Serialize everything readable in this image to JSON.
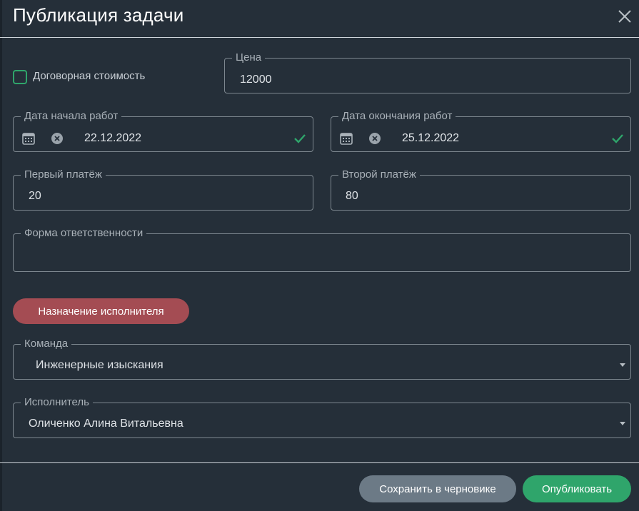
{
  "dialog": {
    "title": "Публикация задачи",
    "close_icon": "close-icon"
  },
  "form": {
    "negotiable_label": "Договорная стоимость",
    "negotiable_checked": false,
    "price": {
      "label": "Цена",
      "value": "12000"
    },
    "start_date": {
      "label": "Дата начала работ",
      "value": "22.12.2022",
      "calendar_icon": "calendar-icon",
      "clear_icon": "clear-icon",
      "valid_icon": "check-icon"
    },
    "end_date": {
      "label": "Дата окончания работ",
      "value": "25.12.2022",
      "calendar_icon": "calendar-icon",
      "clear_icon": "clear-icon",
      "valid_icon": "check-icon"
    },
    "first_payment": {
      "label": "Первый платёж",
      "value": "20"
    },
    "second_payment": {
      "label": "Второй платёж",
      "value": "80"
    },
    "responsibility": {
      "label": "Форма ответственности",
      "value": ""
    },
    "assign_button": "Назначение исполнителя",
    "team": {
      "label": "Команда",
      "value": "Инженерные изыскания"
    },
    "executor": {
      "label": "Исполнитель",
      "value": "Оличенко Алина Витальевна"
    }
  },
  "footer": {
    "save_draft": "Сохранить в черновике",
    "publish": "Опубликовать"
  },
  "colors": {
    "background": "#252f39",
    "accent_green": "#2fa56b",
    "assign_button": "#a44c53",
    "draft_button": "#6c7a86"
  }
}
